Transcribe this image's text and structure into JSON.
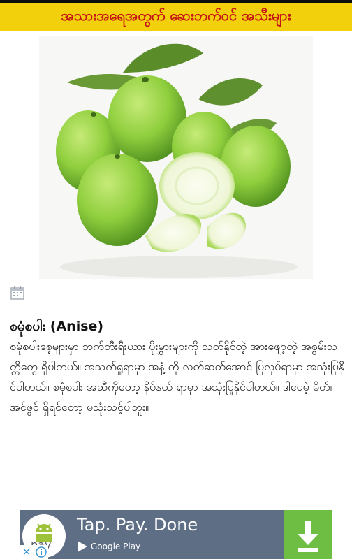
{
  "header": {
    "title": "အသားအရေအတွက် ဆေးဘက်ဝင် အသီးများ",
    "background_color": "#f2d00b",
    "title_color": "#c51416"
  },
  "hero": {
    "icon": "guava-fruit-image"
  },
  "post": {
    "date_icon": "calendar-icon",
    "title": "စမုံစပါး (Anise)",
    "body": "စမုံစပါးစေ့များမှာ ဘက်တီးရီးယား ပိုးမွှားများကို သတ်နိုင်တဲ့ အားဖျော့တဲ့ အစွမ်းသတ္တိတွေ ရှိပါတယ်။ အသက်ရှူရာမှာ အနံ့ ကို လတ်ဆတ်အောင် ပြုလုပ်ရာမှာ အသုံးပြုနိုင်ပါတယ်။ စမုံစပါး အဆီကိုတော့ နိပ်နယ် ရာမှာ အသုံးပြုနိုင်ပါတယ်။ ဒါပေမဲ့ မိတ်၊ အင်ဖွင် ရှိရင်တော့ မသုံးသင့်ပါဘူး။"
  },
  "ad": {
    "logo_icon": "android-pay-logo-icon",
    "logo_text": "pay",
    "headline": "Tap. Pay. Done",
    "store_icon": "google-play-icon",
    "store_label": "Google Play",
    "download_icon": "download-arrow-icon",
    "close_label": "✕",
    "info_icon": "info-icon",
    "background_color": "#5e6e85",
    "button_color": "#6fbe44"
  }
}
